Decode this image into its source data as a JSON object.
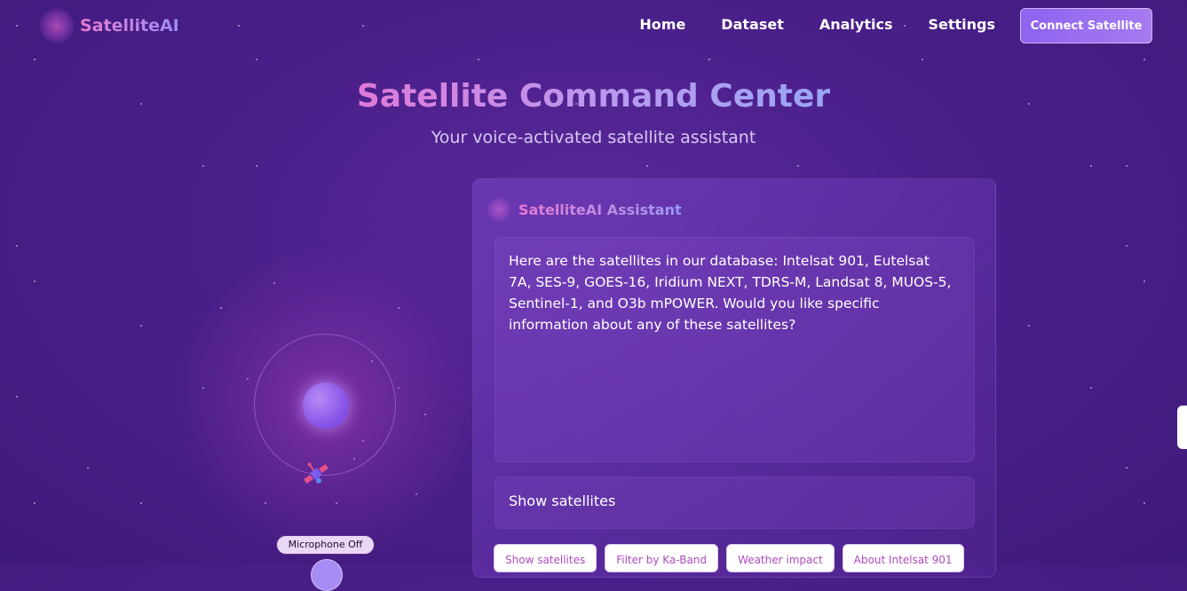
{
  "brand": {
    "name": "SatelliteAI"
  },
  "nav": {
    "items": [
      {
        "label": "Home"
      },
      {
        "label": "Dataset"
      },
      {
        "label": "Analytics"
      },
      {
        "label": "Settings"
      }
    ],
    "connect_label": "Connect Satellite"
  },
  "hero": {
    "title": "Satellite Command Center",
    "subtitle": "Your voice-activated satellite assistant"
  },
  "voice": {
    "status": "Microphone Off",
    "orb_icon": "voice-orb-icon",
    "satellite_icon": "satellite-icon",
    "mic_icon": "microphone-icon"
  },
  "assistant": {
    "title": "SatelliteAI Assistant",
    "message": "Here are the satellites in our database: Intelsat 901, Eutelsat 7A, SES-9, GOES-16, Iridium NEXT, TDRS-M, Landsat 8, MUOS-5, Sentinel-1, and O3b mPOWER. Would you like specific information about any of these satellites?",
    "last_command": "Show satellites",
    "suggestions": [
      {
        "label": "Show satellites"
      },
      {
        "label": "Filter by Ka-Band"
      },
      {
        "label": "Weather impact"
      },
      {
        "label": "About Intelsat 901"
      }
    ]
  },
  "colors": {
    "background": "#4a1f8a",
    "accent_pink": "#e77bd0",
    "accent_violet": "#9a8cf5",
    "button": "#8e63f0"
  }
}
